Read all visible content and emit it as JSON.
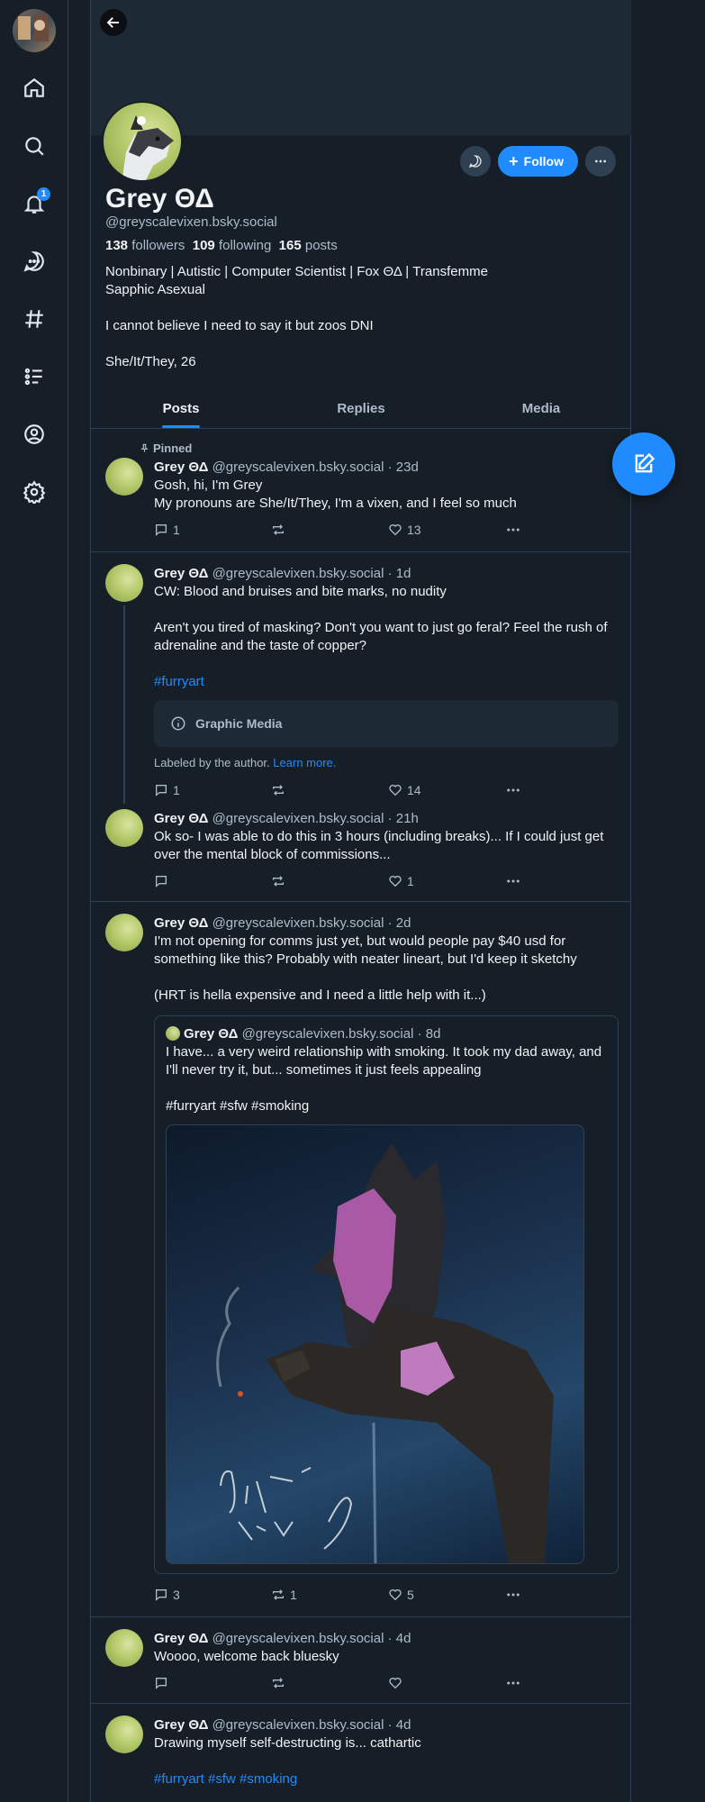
{
  "nav": {
    "notification_count": "1",
    "items": [
      "home",
      "search",
      "notifications",
      "chat",
      "feeds",
      "lists",
      "profile",
      "settings"
    ]
  },
  "profile": {
    "display_name": "Grey ΘΔ",
    "handle": "@greyscalevixen.bsky.social",
    "followers_count": "138",
    "followers_label": "followers",
    "following_count": "109",
    "following_label": "following",
    "posts_count": "165",
    "posts_label": "posts",
    "bio": "Nonbinary | Autistic | Computer Scientist | Fox ΘΔ | Transfemme\nSapphic Asexual\n\nI cannot believe I need to say it but zoos DNI\n\nShe/It/They, 26",
    "follow_label": "Follow"
  },
  "tabs": [
    "Posts",
    "Replies",
    "Media"
  ],
  "posts": [
    {
      "pinned_label": "Pinned",
      "name": "Grey ΘΔ",
      "handle": "@greyscalevixen.bsky.social",
      "time": "· 23d",
      "text": "Gosh, hi, I'm Grey\nMy pronouns are She/It/They, I'm a vixen, and I feel so much",
      "replies": "1",
      "reposts": "",
      "likes": "13"
    },
    {
      "name": "Grey ΘΔ",
      "handle": "@greyscalevixen.bsky.social",
      "time": "· 1d",
      "text": "CW: Blood and bruises and bite marks, no nudity\n\nAren't you tired of masking? Don't you want to just go feral? Feel the rush of adrenaline and the taste of copper?",
      "hashtags": "#furryart",
      "graphic_label": "Graphic Media",
      "labeled_text": "Labeled by the author.",
      "learn_more": "Learn more.",
      "replies": "1",
      "reposts": "",
      "likes": "14"
    },
    {
      "name": "Grey ΘΔ",
      "handle": "@greyscalevixen.bsky.social",
      "time": "· 21h",
      "text": "Ok so- I was able to do this in 3 hours (including breaks)... If I could just get over the mental block of commissions...",
      "replies": "",
      "reposts": "",
      "likes": "1"
    },
    {
      "name": "Grey ΘΔ",
      "handle": "@greyscalevixen.bsky.social",
      "time": "· 2d",
      "text": "I'm not opening for comms just yet, but would people pay $40 usd for something like this? Probably with neater lineart, but I'd keep it sketchy\n\n(HRT is hella expensive and I need a little help with it...)",
      "quote": {
        "name": "Grey ΘΔ",
        "handle": "@greyscalevixen.bsky.social",
        "time": "· 8d",
        "text": "I have... a very weird relationship with smoking. It took my dad away, and I'll never try it, but... sometimes it just feels appealing",
        "hashtags": "#furryart #sfw #smoking"
      },
      "replies": "3",
      "reposts": "1",
      "likes": "5"
    },
    {
      "name": "Grey ΘΔ",
      "handle": "@greyscalevixen.bsky.social",
      "time": "· 4d",
      "text": "Woooo, welcome back bluesky",
      "replies": "",
      "reposts": "",
      "likes": ""
    },
    {
      "name": "Grey ΘΔ",
      "handle": "@greyscalevixen.bsky.social",
      "time": "· 4d",
      "text": "Drawing myself self-destructing is... cathartic",
      "hashtags": "#furryart #sfw #smoking"
    }
  ],
  "colors": {
    "accent": "#208bfe",
    "background": "#161e27",
    "border": "#2e4052",
    "muted": "#aebbc9"
  }
}
